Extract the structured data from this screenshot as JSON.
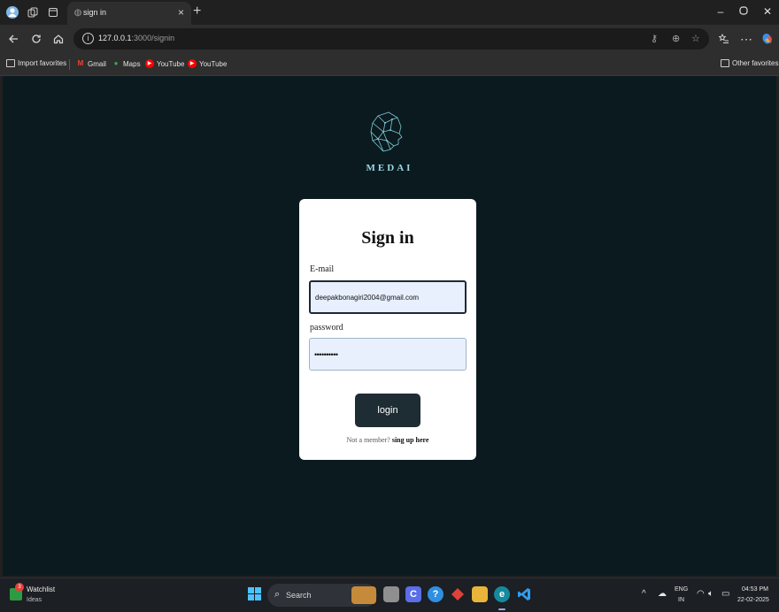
{
  "browser": {
    "tab_title": "sign in",
    "tab_close": "×",
    "new_tab": "+",
    "url_host": "127.0.0.1",
    "url_path": ":3000/signin",
    "window": {
      "minimize": "–",
      "maximize": "▢",
      "close": "✕"
    }
  },
  "favorites": {
    "items": [
      {
        "label": "Import favorites",
        "icon": "folder-import-icon"
      },
      {
        "label": "Gmail",
        "icon": "gmail-icon"
      },
      {
        "label": "Maps",
        "icon": "maps-icon"
      },
      {
        "label": "YouTube",
        "icon": "youtube-icon"
      },
      {
        "label": "YouTube",
        "icon": "youtube-icon"
      }
    ],
    "other": "Other favorites"
  },
  "page": {
    "brand": "MEDAI",
    "title": "Sign in",
    "email_label": "E-mail",
    "email_value": "deepakbonagiri2004@gmail.com",
    "password_label": "password",
    "password_value": "••••••••••",
    "login_label": "login",
    "member_text": "Not a member?",
    "signup_link": "sing up here",
    "colors": {
      "page_bg": "#0b1a1f",
      "button_bg": "#1e2c33",
      "brand": "#9ad9e6"
    }
  },
  "taskbar": {
    "widget_title": "Watchlist",
    "widget_sub": "Ideas",
    "widget_badge": "3",
    "search_placeholder": "Search",
    "lang_top": "ENG",
    "lang_bottom": "IN",
    "time": "04:53 PM",
    "date": "22-02-2025"
  }
}
